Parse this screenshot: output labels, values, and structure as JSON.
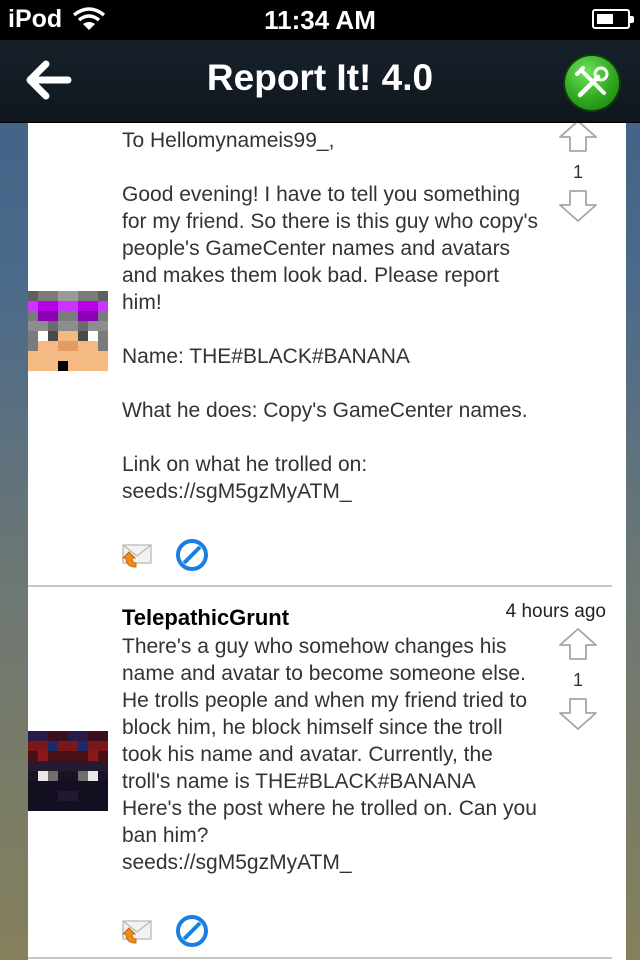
{
  "status": {
    "carrier": "iPod",
    "time": "11:34 AM"
  },
  "nav": {
    "title": "Report It! 4.0"
  },
  "icons": {
    "back": "back-arrow-icon",
    "tools": "tools-icon",
    "upvote": "up-arrow-icon",
    "downvote": "down-arrow-icon",
    "reply": "reply-envelope-icon",
    "ban": "ban-icon"
  },
  "colors": {
    "nav_bg": "#111a22",
    "tools_green": "#2fa81f",
    "ban_blue": "#1a7fe0"
  },
  "posts": [
    {
      "body": "To Hellomynameis99_,\n\nGood evening! I have to tell you something for my friend. So there is this guy who copy's people's GameCenter names and avatars and makes them look bad. Please report him!\n\nName: THE#BLACK#BANANA\n\nWhat he does: Copy's GameCenter names.\n\nLink on what he trolled on:\nseeds://sgM5gzMyATM_",
      "votes": "1"
    },
    {
      "author": "TelepathicGrunt",
      "time_ago": "4 hours ago",
      "body": "There's a guy who somehow changes his name and avatar to become someone else. He trolls people and when my friend tried to block him, he block himself since the troll took his name and avatar. Currently, the troll's name is THE#BLACK#BANANA\nHere's the post where he trolled on. Can you ban him?\nseeds://sgM5gzMyATM_",
      "votes": "1"
    }
  ]
}
